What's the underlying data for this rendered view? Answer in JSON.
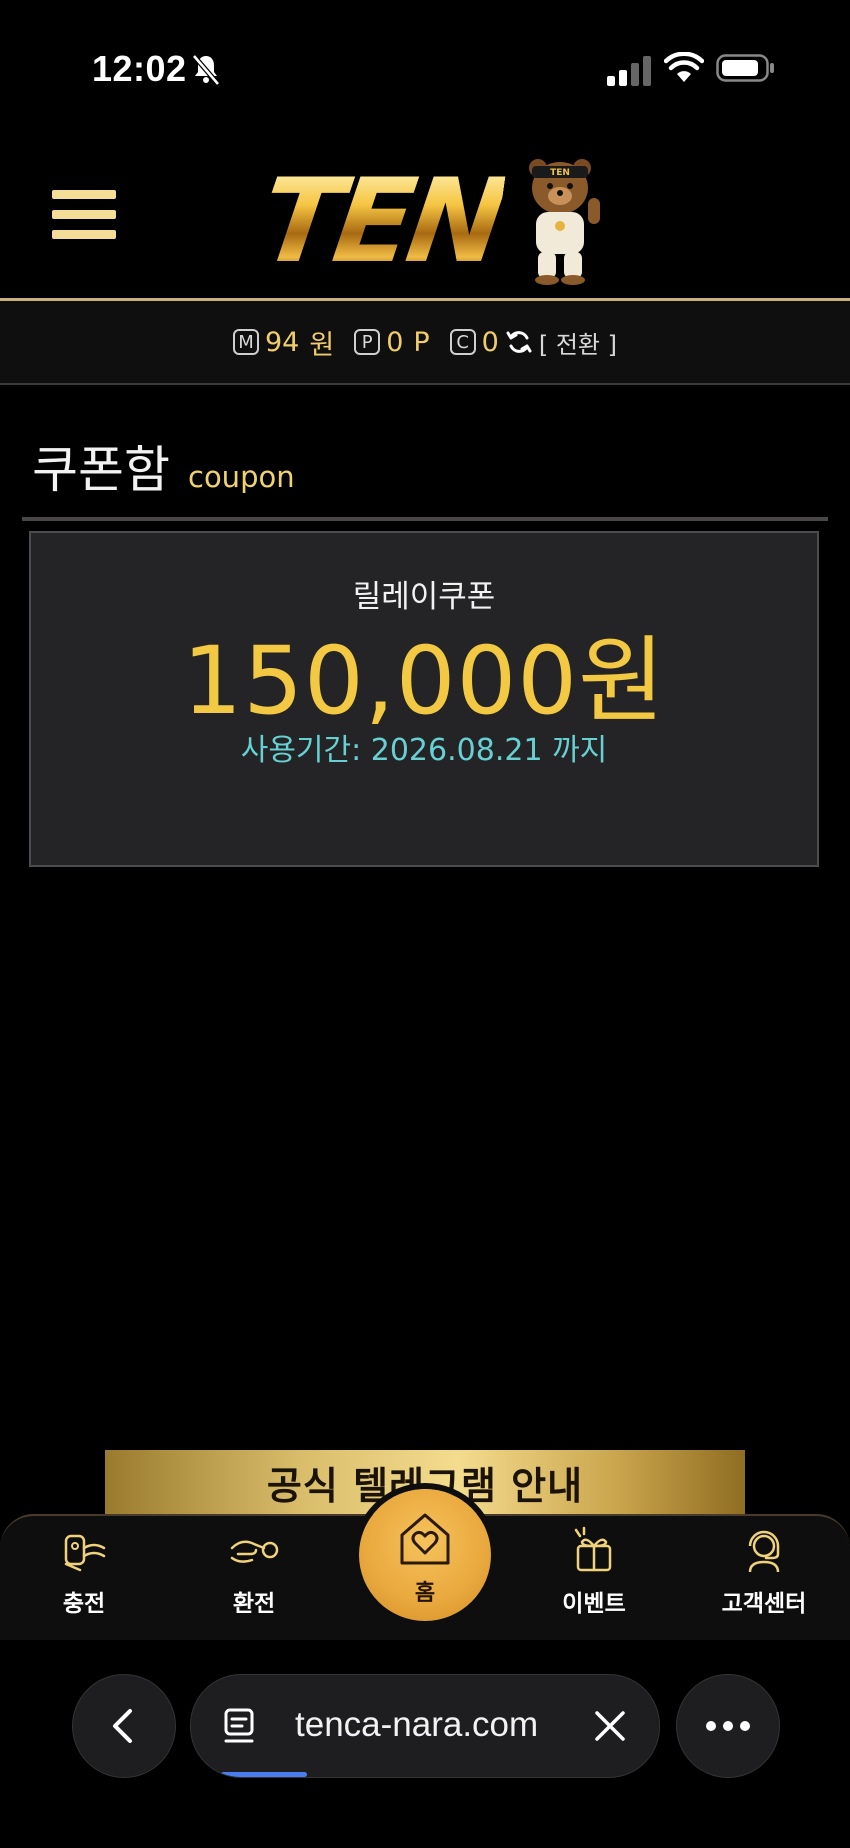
{
  "status_bar": {
    "time": "12:02",
    "icons": [
      "bell-slash-icon",
      "signal-icon",
      "wifi-icon",
      "battery-icon"
    ]
  },
  "header": {
    "logo_text": "TEN",
    "logo_badge_text": "TEN",
    "menu_icon": "hamburger-menu-icon"
  },
  "balance": {
    "money_badge": "M",
    "money_value": "94",
    "money_unit": "원",
    "point_badge": "P",
    "point_value": "0",
    "point_unit": "P",
    "casino_badge": "C",
    "casino_value": "0",
    "convert_label": "[ 전환 ]"
  },
  "page": {
    "title": "쿠폰함",
    "subtitle": "coupon"
  },
  "coupons": [
    {
      "name": "릴레이쿠폰",
      "amount": "150,000원",
      "expiry": "사용기간: 2026.08.21 까지"
    }
  ],
  "banner": {
    "text": "공식 텔레그램 안내"
  },
  "bottom_nav": {
    "items": [
      {
        "label": "충전",
        "icon": "deposit-icon"
      },
      {
        "label": "환전",
        "icon": "withdraw-icon"
      },
      {
        "label": "홈",
        "icon": "home-heart-icon"
      },
      {
        "label": "이벤트",
        "icon": "gift-icon"
      },
      {
        "label": "고객센터",
        "icon": "support-agent-icon"
      }
    ]
  },
  "browser": {
    "url": "tenca-nara.com"
  },
  "colors": {
    "gold": "#f3c943",
    "accent_cyan": "#66d0d2",
    "home_button": "#e9a83d",
    "background": "#000000",
    "card_background": "#242426"
  }
}
